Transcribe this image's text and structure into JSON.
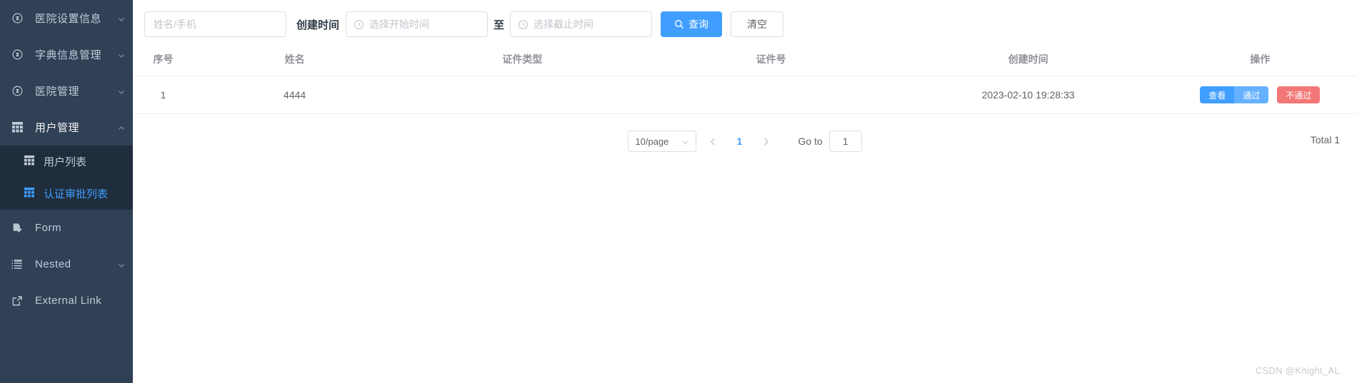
{
  "sidebar": {
    "bg_color": "#304156",
    "submenu_bg_color": "#1f2d3d",
    "active_color": "#409EFF",
    "items": [
      {
        "label": "医院设置信息",
        "icon": "compass-icon",
        "has_children": true
      },
      {
        "label": "字典信息管理",
        "icon": "compass-icon",
        "has_children": true
      },
      {
        "label": "医院管理",
        "icon": "compass-icon",
        "has_children": true
      },
      {
        "label": "用户管理",
        "icon": "table-icon",
        "has_children": true,
        "expanded": true,
        "active": true
      }
    ],
    "submenu": [
      {
        "label": "用户列表",
        "icon": "table-icon",
        "selected": false
      },
      {
        "label": "认证审批列表",
        "icon": "table-icon",
        "selected": true
      }
    ],
    "tail_items": [
      {
        "label": "Form",
        "icon": "form-icon",
        "has_children": false
      },
      {
        "label": "Nested",
        "icon": "nested-list-icon",
        "has_children": true
      },
      {
        "label": "External Link",
        "icon": "external-link-icon",
        "has_children": false
      }
    ]
  },
  "toolbar": {
    "name_input": {
      "value": "",
      "placeholder": "姓名/手机"
    },
    "created_time_label": "创建时间",
    "start_time": {
      "value": "",
      "placeholder": "选择开始时间",
      "icon": "clock-icon"
    },
    "to_label": "至",
    "end_time": {
      "value": "",
      "placeholder": "选择截止时间",
      "icon": "clock-icon"
    },
    "search_button": {
      "label": "查询",
      "icon": "search-icon",
      "color": "#409EFF"
    },
    "clear_button": {
      "label": "清空"
    }
  },
  "table": {
    "columns": [
      "序号",
      "姓名",
      "证件类型",
      "证件号",
      "创建时间",
      "操作"
    ],
    "rows": [
      {
        "index": "1",
        "name": "4444",
        "cert_type": "",
        "cert_no": "",
        "created_time": "2023-02-10 19:28:33",
        "actions": [
          {
            "label": "查看",
            "color": "#409EFF"
          },
          {
            "label": "通过",
            "color": "#66b1ff"
          },
          {
            "label": "不通过",
            "color": "#f47777"
          }
        ]
      }
    ]
  },
  "pagination": {
    "page_size": "10/page",
    "prev_icon": "chevron-left-icon",
    "next_icon": "chevron-right-icon",
    "current_page": "1",
    "goto_label": "Go to",
    "goto_value": "1",
    "total_label": "Total 1"
  },
  "watermark": "CSDN @Knight_AL"
}
